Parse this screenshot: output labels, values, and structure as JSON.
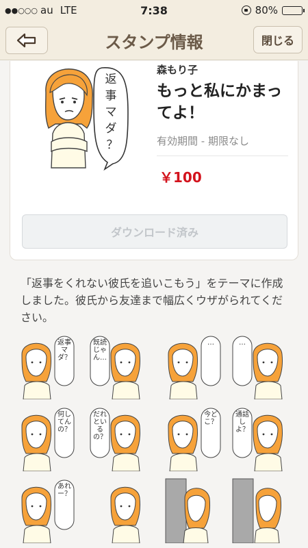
{
  "status_bar": {
    "signal": "●●○○○",
    "carrier": "au",
    "network": "LTE",
    "time": "7:38",
    "battery": "80%",
    "battery_fraction": 0.8
  },
  "nav": {
    "title": "スタンプ情報",
    "close_label": "閉じる"
  },
  "stamp": {
    "author": "森もり子",
    "title": "もっと私にかまってよ！",
    "validity": "有効期間 - 期限なし",
    "price": "￥100",
    "download_label": "ダウンロード済み",
    "hero_speech": "返事マダ？"
  },
  "description": "「返事をくれない彼氏を追いこもう」をテーマに作成しました。彼氏から友達まで幅広くウザがられてください。",
  "stickers": [
    {
      "text": "返事マダ？"
    },
    {
      "text": "既読じゃん…"
    },
    {
      "text": "…"
    },
    {
      "text": "…"
    },
    {
      "text": "何してんの？"
    },
    {
      "text": "だれといるの？"
    },
    {
      "text": "今どこ？"
    },
    {
      "text": "通話しよ？"
    },
    {
      "text": "あれー？"
    },
    {
      "text": ""
    },
    {
      "text": ""
    },
    {
      "text": ""
    }
  ],
  "colors": {
    "accent_brown": "#6b5a48",
    "price_red": "#d3131d",
    "hair": "#f6a23a"
  }
}
